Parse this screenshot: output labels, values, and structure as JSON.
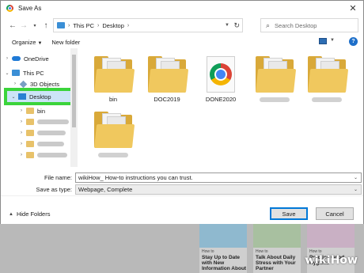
{
  "window": {
    "title": "Save As",
    "close": "✕"
  },
  "address": {
    "crumbs": [
      "This PC",
      "Desktop"
    ],
    "search_placeholder": "Search Desktop"
  },
  "command_bar": {
    "organize": "Organize",
    "new_folder": "New folder",
    "help": "?"
  },
  "nav_pane": {
    "items": [
      {
        "label": "OneDrive"
      },
      {
        "label": "This PC"
      },
      {
        "label": "3D Objects"
      },
      {
        "label": "Desktop"
      },
      {
        "label": "bin"
      }
    ]
  },
  "files": [
    {
      "name": "bin",
      "type": "folder"
    },
    {
      "name": "DOC2019",
      "type": "folder"
    },
    {
      "name": "DONE2020",
      "type": "chrome-file"
    }
  ],
  "form": {
    "file_name_label": "File name:",
    "file_name_value": "wikiHow_ How-to instructions you can trust.",
    "save_type_label": "Save as type:",
    "save_type_value": "Webpage, Complete"
  },
  "footer": {
    "hide_folders": "Hide Folders",
    "save": "Save",
    "cancel": "Cancel"
  },
  "background_cards": [
    {
      "tag": "How to",
      "headline": "Stay Up to Date with New Information About"
    },
    {
      "tag": "How to",
      "headline": "Talk About Daily Stress with Your Partner"
    },
    {
      "tag": "How to",
      "headline": "Practice Good Hygiene"
    }
  ],
  "watermark": {
    "wiki": "wiki",
    "how": "How"
  },
  "colors": {
    "highlight": "#3bd43b",
    "accent": "#0078d7",
    "folder": "#f0c85e"
  }
}
